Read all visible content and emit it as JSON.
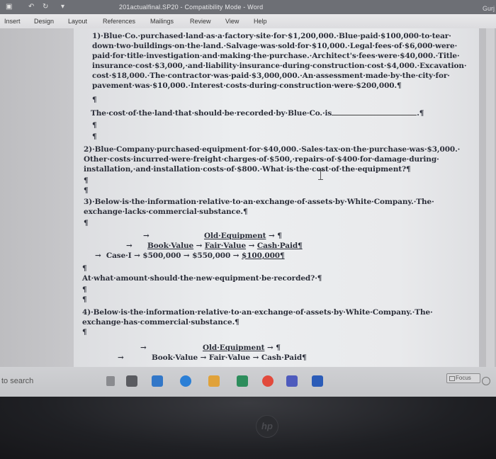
{
  "window": {
    "title": "201actualfinal.SP20  -  Compatibility Mode  -  Word",
    "user": "Gurj"
  },
  "ribbon_tabs": [
    "Insert",
    "Design",
    "Layout",
    "References",
    "Mailings",
    "Review",
    "View",
    "Help"
  ],
  "document": {
    "lines": [
      "1)·Blue·Co.·purchased·land·as·a·factory·site·for·$1,200,000.·Blue·paid·$100,000·to·tear·",
      "down·two·buildings·on·the·land.·Salvage·was·sold·for·$10,000.·Legal·fees·of·$6,000·were·",
      "paid·for·title·investigation·and·making·the·purchase.·Architect's·fees·were·$40,000.·Title·",
      "insurance·cost·$3,000,·and·liability·insurance·during·construction·cost·$4,000.·Excavation·",
      "cost·$18,000.·The·contractor·was·paid·$3,000,000.·An·assessment·made·by·the·city·for·",
      "pavement·was·$10,000.·Interest·costs·during·construction·were·$200,000.¶",
      "¶",
      "The·cost·of·the·land·that·should·be·recorded·by·Blue·Co.·is",
      "¶",
      "¶",
      "2)·Blue·Company·purchased·equipment·for·$40,000.·Sales·tax·on·the·purchase·was·$3,000.·",
      "Other·costs·incurred·were·freight·charges·of·$500,·repairs·of·$400·for·damage·during·",
      "installation,·and·installation·costs·of·$800.·What·is·the·cost·of·the·equipment?¶",
      "¶",
      "¶",
      "3)·Below·is·the·information·relative·to·an·exchange·of·assets·by·White·Company.·The·",
      "exchange·lacks·commercial·substance.¶",
      "¶",
      "At·what·amount·should·the·new·equipment·be·recorded?·¶",
      "¶",
      "¶",
      "4)·Below·is·the·information·relative·to·an·exchange·of·assets·by·White·Company.·The·",
      "exchange·has·commercial·substance.¶",
      "¶"
    ],
    "land_cost_end": ".¶",
    "table3": {
      "arrow1": "→",
      "header": "Old·Equipment",
      "header_tail": " → ¶",
      "arrow2": "→",
      "col1": "Book·Value",
      "col2": "Fair·Value",
      "col3": "Cash·Paid¶",
      "sep": " → ",
      "row_label": "Case·I",
      "row_arrow": "→",
      "v1": "$500,000",
      "v2": "$550,000",
      "v3": "$100,000¶",
      "after": "¶"
    },
    "table4": {
      "arrow1": "→",
      "header": "Old·Equipment",
      "header_tail": " → ¶",
      "arrow2": "→",
      "col1": "Book·Value",
      "col2": "Fair·Value",
      "col3": "Cash·Paid¶"
    }
  },
  "status": {
    "focus_label": "Focus"
  },
  "taskbar": {
    "search_placeholder": "to search"
  },
  "laptop": {
    "brand": "hp"
  }
}
